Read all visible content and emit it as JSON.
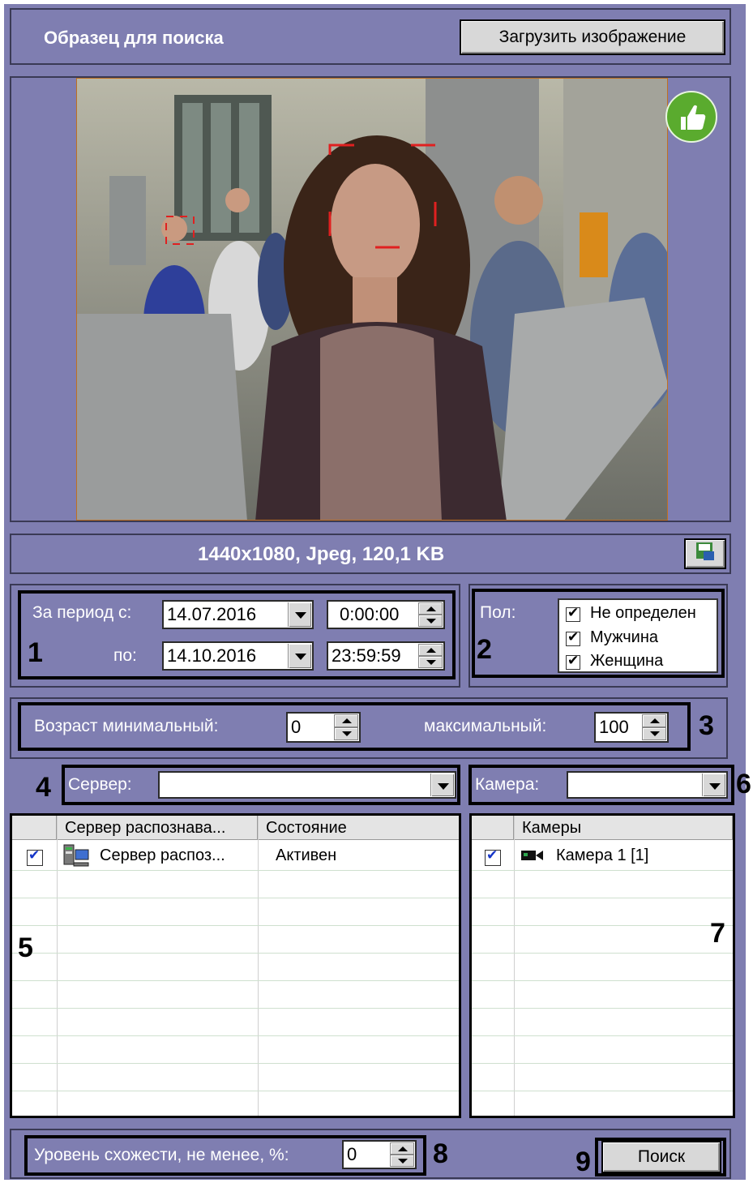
{
  "header": {
    "title": "Образец для поиска",
    "load_button": "Загрузить изображение"
  },
  "image_info": "1440x1080, Jpeg, 120,1 KB",
  "period": {
    "from_label": "За период с:",
    "to_label": "по:",
    "from_date": "14.07.2016",
    "from_time": "0:00:00",
    "to_date": "14.10.2016",
    "to_time": "23:59:59"
  },
  "gender": {
    "label": "Пол:",
    "options": [
      "Не определен",
      "Мужчина",
      "Женщина"
    ]
  },
  "age": {
    "min_label": "Возраст минимальный:",
    "min_value": "0",
    "max_label": "максимальный:",
    "max_value": "100"
  },
  "server": {
    "label": "Сервер:",
    "value": ""
  },
  "camera": {
    "label": "Камера:",
    "value": ""
  },
  "server_table": {
    "columns": [
      "Сервер распознава...",
      "Состояние"
    ],
    "rows": [
      {
        "name": "Сервер распоз...",
        "status": "Активен",
        "checked": true
      }
    ]
  },
  "camera_table": {
    "columns": [
      "Камеры"
    ],
    "rows": [
      {
        "name": "Камера 1 [1]",
        "checked": true
      }
    ]
  },
  "similarity": {
    "label": "Уровень схожести, не менее, %:",
    "value": "0"
  },
  "search_button": "Поиск",
  "callouts": [
    "1",
    "2",
    "3",
    "4",
    "5",
    "6",
    "7",
    "8",
    "9"
  ],
  "colors": {
    "panel": "#7f7eb1",
    "face_frame": "#e02020",
    "thumb_badge": "#5aab2e"
  },
  "icons": [
    "thumbs-up-icon",
    "save-image-icon",
    "server-icon",
    "camera-icon",
    "dropdown-arrow-icon",
    "spin-arrows-icon"
  ]
}
